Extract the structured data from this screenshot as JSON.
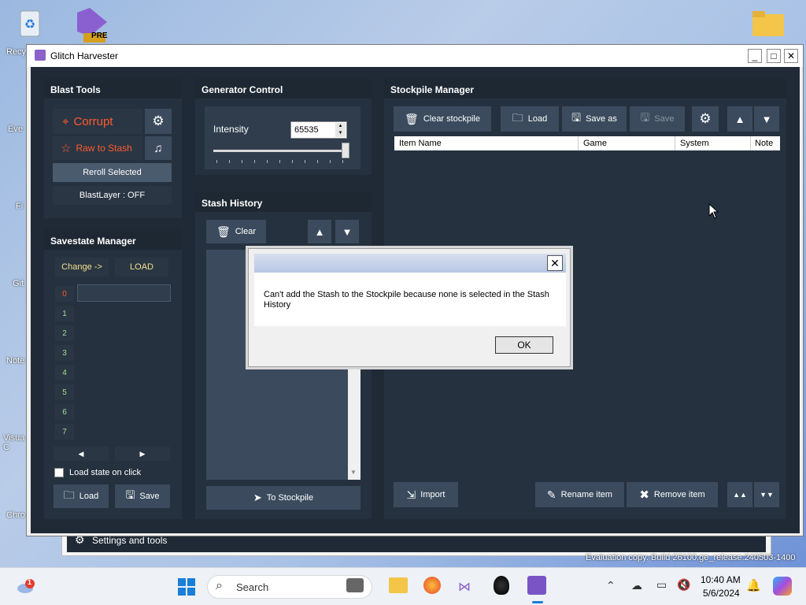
{
  "desktop": {
    "icons": [
      "Recy",
      "Eve",
      "Fi",
      "Git",
      "Note",
      "Visua C",
      "Chro"
    ],
    "preBadge": "PRE",
    "evaluation": "Evaluation copy. Build 26100.ge_release.240503-1400"
  },
  "window": {
    "title": "Glitch Harvester",
    "minimize": "_",
    "maximize": "□",
    "close": "✕"
  },
  "blastTools": {
    "header": "Blast Tools",
    "corrupt": "Corrupt",
    "rawToStash": "Raw to Stash",
    "rerollSelected": "Reroll Selected",
    "blastLayer": "BlastLayer : OFF"
  },
  "savestate": {
    "header": "Savestate Manager",
    "change": "Change ->",
    "load": "LOAD",
    "slots": [
      "0",
      "1",
      "2",
      "3",
      "4",
      "5",
      "6",
      "7"
    ],
    "loadStateOnClick": "Load state on click",
    "loadBtn": "Load",
    "saveBtn": "Save"
  },
  "generator": {
    "header": "Generator Control",
    "intensityLabel": "Intensity",
    "intensityValue": "65535"
  },
  "stashHistory": {
    "header": "Stash History",
    "clear": "Clear",
    "toStockpile": "To Stockpile"
  },
  "stockpile": {
    "header": "Stockpile Manager",
    "clearStockpile": "Clear stockpile",
    "load": "Load",
    "saveAs": "Save as",
    "save": "Save",
    "columns": [
      "Item Name",
      "Game",
      "System",
      "Note"
    ],
    "import": "Import",
    "renameItem": "Rename item",
    "removeItem": "Remove item"
  },
  "dialog": {
    "message": "Can't add the Stash to the Stockpile because none is selected in the Stash History",
    "ok": "OK",
    "close": "✕"
  },
  "backWindow": {
    "settings": "Settings and tools"
  },
  "taskbar": {
    "search": "Search",
    "time": "10:40 AM",
    "date": "5/6/2024",
    "weatherBadge": "1"
  },
  "colors": {
    "corrupt": "#ff5a2e",
    "slotZero": "#ff5a2e",
    "slotOthers": "#9fe08f",
    "change": "#f5e08c"
  }
}
